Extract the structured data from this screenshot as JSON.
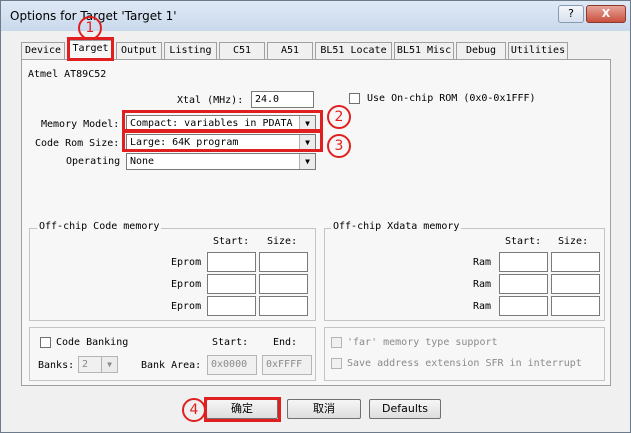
{
  "window": {
    "title": "Options for Target 'Target 1'",
    "help": "?",
    "close": "X"
  },
  "tabs": [
    {
      "label": "Device"
    },
    {
      "label": "Target"
    },
    {
      "label": "Output"
    },
    {
      "label": "Listing"
    },
    {
      "label": "C51"
    },
    {
      "label": "A51"
    },
    {
      "label": "BL51 Locate"
    },
    {
      "label": "BL51 Misc"
    },
    {
      "label": "Debug"
    },
    {
      "label": "Utilities"
    }
  ],
  "target": {
    "device_name": "Atmel AT89C52",
    "xtal_label": "Xtal (MHz):",
    "xtal_value": "24.0",
    "onchip_rom_label": "Use On-chip ROM (0x0-0x1FFF)",
    "memory_model_label": "Memory Model:",
    "memory_model_value": "Compact: variables in PDATA",
    "code_rom_label": "Code Rom Size:",
    "code_rom_value": "Large: 64K program",
    "operating_label": "Operating",
    "operating_value": "None"
  },
  "code_memory": {
    "title": "Off-chip Code memory",
    "start": "Start:",
    "size": "Size:",
    "rows": [
      {
        "label": "Eprom"
      },
      {
        "label": "Eprom"
      },
      {
        "label": "Eprom"
      }
    ]
  },
  "xdata_memory": {
    "title": "Off-chip Xdata memory",
    "start": "Start:",
    "size": "Size:",
    "rows": [
      {
        "label": "Ram"
      },
      {
        "label": "Ram"
      },
      {
        "label": "Ram"
      }
    ]
  },
  "banking": {
    "code_banking_label": "Code Banking",
    "start": "Start:",
    "end": "End:",
    "banks_label": "Banks:",
    "banks_value": "2",
    "bank_area_label": "Bank Area:",
    "bank_area_start": "0x0000",
    "bank_area_end": "0xFFFF"
  },
  "options": {
    "far_memory": "'far' memory type support",
    "save_sfr": "Save address extension SFR in interrupt"
  },
  "buttons": {
    "ok": "确定",
    "cancel": "取消",
    "defaults": "Defaults"
  },
  "annotations": {
    "n1": "1",
    "n2": "2",
    "n3": "3",
    "n4": "4",
    "color": "#e02020"
  }
}
